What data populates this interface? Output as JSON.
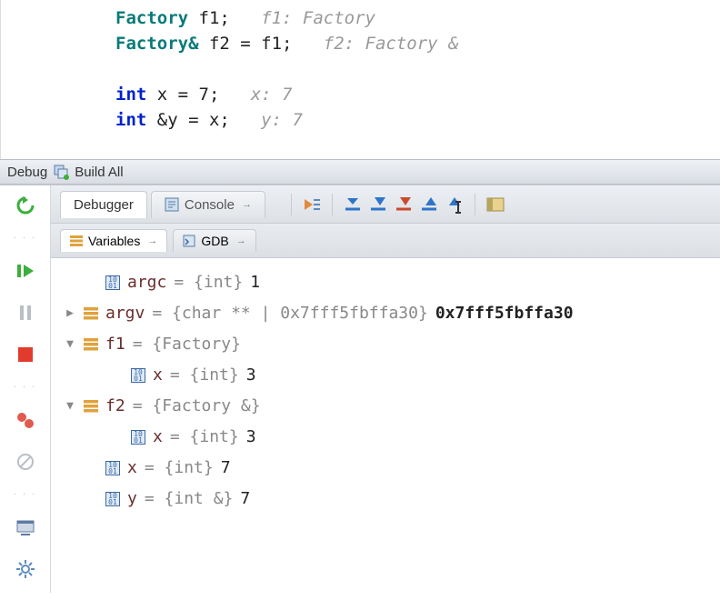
{
  "code": {
    "l1_type": "Factory",
    "l1_rest": " f1;   ",
    "l1_hint": "f1: Factory",
    "l2_type": "Factory&",
    "l2_rest": " f2 = f1;   ",
    "l2_hint": "f2: Factory &",
    "l4_kw": "int",
    "l4_rest": " x = 7;   ",
    "l4_hint": "x: 7",
    "l5_kw": "int",
    "l5_rest": " &y = x;   ",
    "l5_hint": "y: 7"
  },
  "toolbar": {
    "debug_label": "Debug",
    "build_label": "Build All"
  },
  "tabs": {
    "debugger": "Debugger",
    "console": "Console"
  },
  "subtabs": {
    "variables": "Variables",
    "gdb": "GDB"
  },
  "vars": {
    "argc": {
      "name": "argc",
      "type": "{int}",
      "value": "1"
    },
    "argv": {
      "name": "argv",
      "type": "{char **  | 0x7fff5fbffa30}",
      "value": "0x7fff5fbffa30"
    },
    "f1": {
      "name": "f1",
      "type": "{Factory}",
      "field": {
        "name": "x",
        "type": "{int}",
        "value": "3"
      }
    },
    "f2": {
      "name": "f2",
      "type": "{Factory &}",
      "field": {
        "name": "x",
        "type": "{int}",
        "value": "3"
      }
    },
    "x": {
      "name": "x",
      "type": "{int}",
      "value": "7"
    },
    "y": {
      "name": "y",
      "type": "{int &}",
      "value": "7"
    }
  }
}
